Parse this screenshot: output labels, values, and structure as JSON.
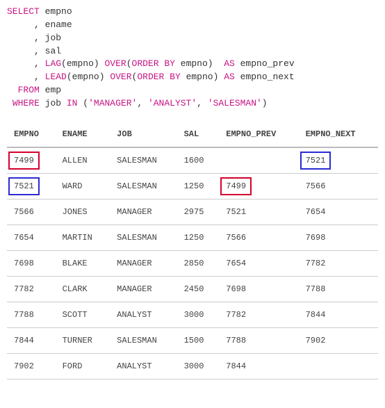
{
  "sql": {
    "kw_select": "SELECT",
    "col0": "empno",
    "col1": "ename",
    "col2": "job",
    "col3": "sal",
    "fn_lag": "LAG",
    "paren_open": "(",
    "paren_close": ")",
    "arg_empno": "empno",
    "kw_over": "OVER",
    "kw_order_by": "ORDER BY",
    "order_col": "empno",
    "kw_as": "AS",
    "alias_prev": "empno_prev",
    "fn_lead": "LEAD",
    "alias_next": "empno_next",
    "kw_from": "FROM",
    "tbl": "emp",
    "kw_where": "WHERE",
    "where_col": "job",
    "kw_in": "IN",
    "lit_mgr": "'MANAGER'",
    "lit_an": "'ANALYST'",
    "lit_sm": "'SALESMAN'",
    "comma": ","
  },
  "headers": {
    "empno": "EMPNO",
    "ename": "ENAME",
    "job": "JOB",
    "sal": "SAL",
    "empno_prev": "EMPNO_PREV",
    "empno_next": "EMPNO_NEXT"
  },
  "rows": [
    {
      "empno": "7499",
      "ename": "ALLEN",
      "job": "SALESMAN",
      "sal": "1600",
      "empno_prev": "",
      "empno_next": "7521",
      "hl_empno": "red",
      "hl_next": "blue"
    },
    {
      "empno": "7521",
      "ename": "WARD",
      "job": "SALESMAN",
      "sal": "1250",
      "empno_prev": "7499",
      "empno_next": "7566",
      "hl_empno": "blue",
      "hl_prev": "red"
    },
    {
      "empno": "7566",
      "ename": "JONES",
      "job": "MANAGER",
      "sal": "2975",
      "empno_prev": "7521",
      "empno_next": "7654"
    },
    {
      "empno": "7654",
      "ename": "MARTIN",
      "job": "SALESMAN",
      "sal": "1250",
      "empno_prev": "7566",
      "empno_next": "7698"
    },
    {
      "empno": "7698",
      "ename": "BLAKE",
      "job": "MANAGER",
      "sal": "2850",
      "empno_prev": "7654",
      "empno_next": "7782"
    },
    {
      "empno": "7782",
      "ename": "CLARK",
      "job": "MANAGER",
      "sal": "2450",
      "empno_prev": "7698",
      "empno_next": "7788"
    },
    {
      "empno": "7788",
      "ename": "SCOTT",
      "job": "ANALYST",
      "sal": "3000",
      "empno_prev": "7782",
      "empno_next": "7844"
    },
    {
      "empno": "7844",
      "ename": "TURNER",
      "job": "SALESMAN",
      "sal": "1500",
      "empno_prev": "7788",
      "empno_next": "7902"
    },
    {
      "empno": "7902",
      "ename": "FORD",
      "job": "ANALYST",
      "sal": "3000",
      "empno_prev": "7844",
      "empno_next": ""
    }
  ]
}
